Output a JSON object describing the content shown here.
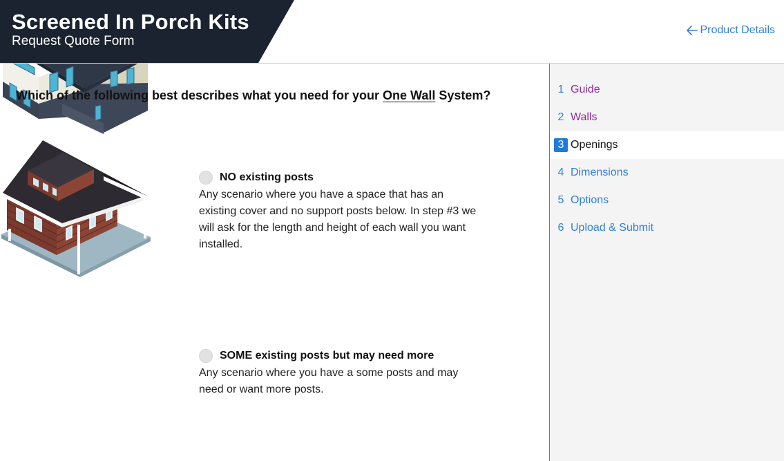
{
  "header": {
    "title": "Screened In Porch Kits",
    "subtitle": "Request Quote Form",
    "back_link": "Product Details"
  },
  "question": {
    "prefix": "Which of the following best describes what you need for your ",
    "emphasis": "One Wall",
    "suffix": " System?"
  },
  "options": [
    {
      "title": "NO existing posts",
      "description": "Any scenario where you have a space that has an existing cover and no support posts below. In step #3 we will ask for the length and height of each wall you want installed."
    },
    {
      "title": "SOME existing posts but may need more",
      "description": "Any scenario where you have a some posts and may need or want more posts."
    }
  ],
  "steps": [
    {
      "num": "1",
      "label": "Guide",
      "state": "visited"
    },
    {
      "num": "2",
      "label": "Walls",
      "state": "visited"
    },
    {
      "num": "3",
      "label": "Openings",
      "state": "active"
    },
    {
      "num": "4",
      "label": "Dimensions",
      "state": "upcoming"
    },
    {
      "num": "5",
      "label": "Options",
      "state": "upcoming"
    },
    {
      "num": "6",
      "label": "Upload & Submit",
      "state": "upcoming"
    }
  ],
  "colors": {
    "brand_dark": "#1b2331",
    "link_blue": "#2f7fd8",
    "visited_purple": "#8e2a9b",
    "active_blue": "#1f7ae0"
  }
}
